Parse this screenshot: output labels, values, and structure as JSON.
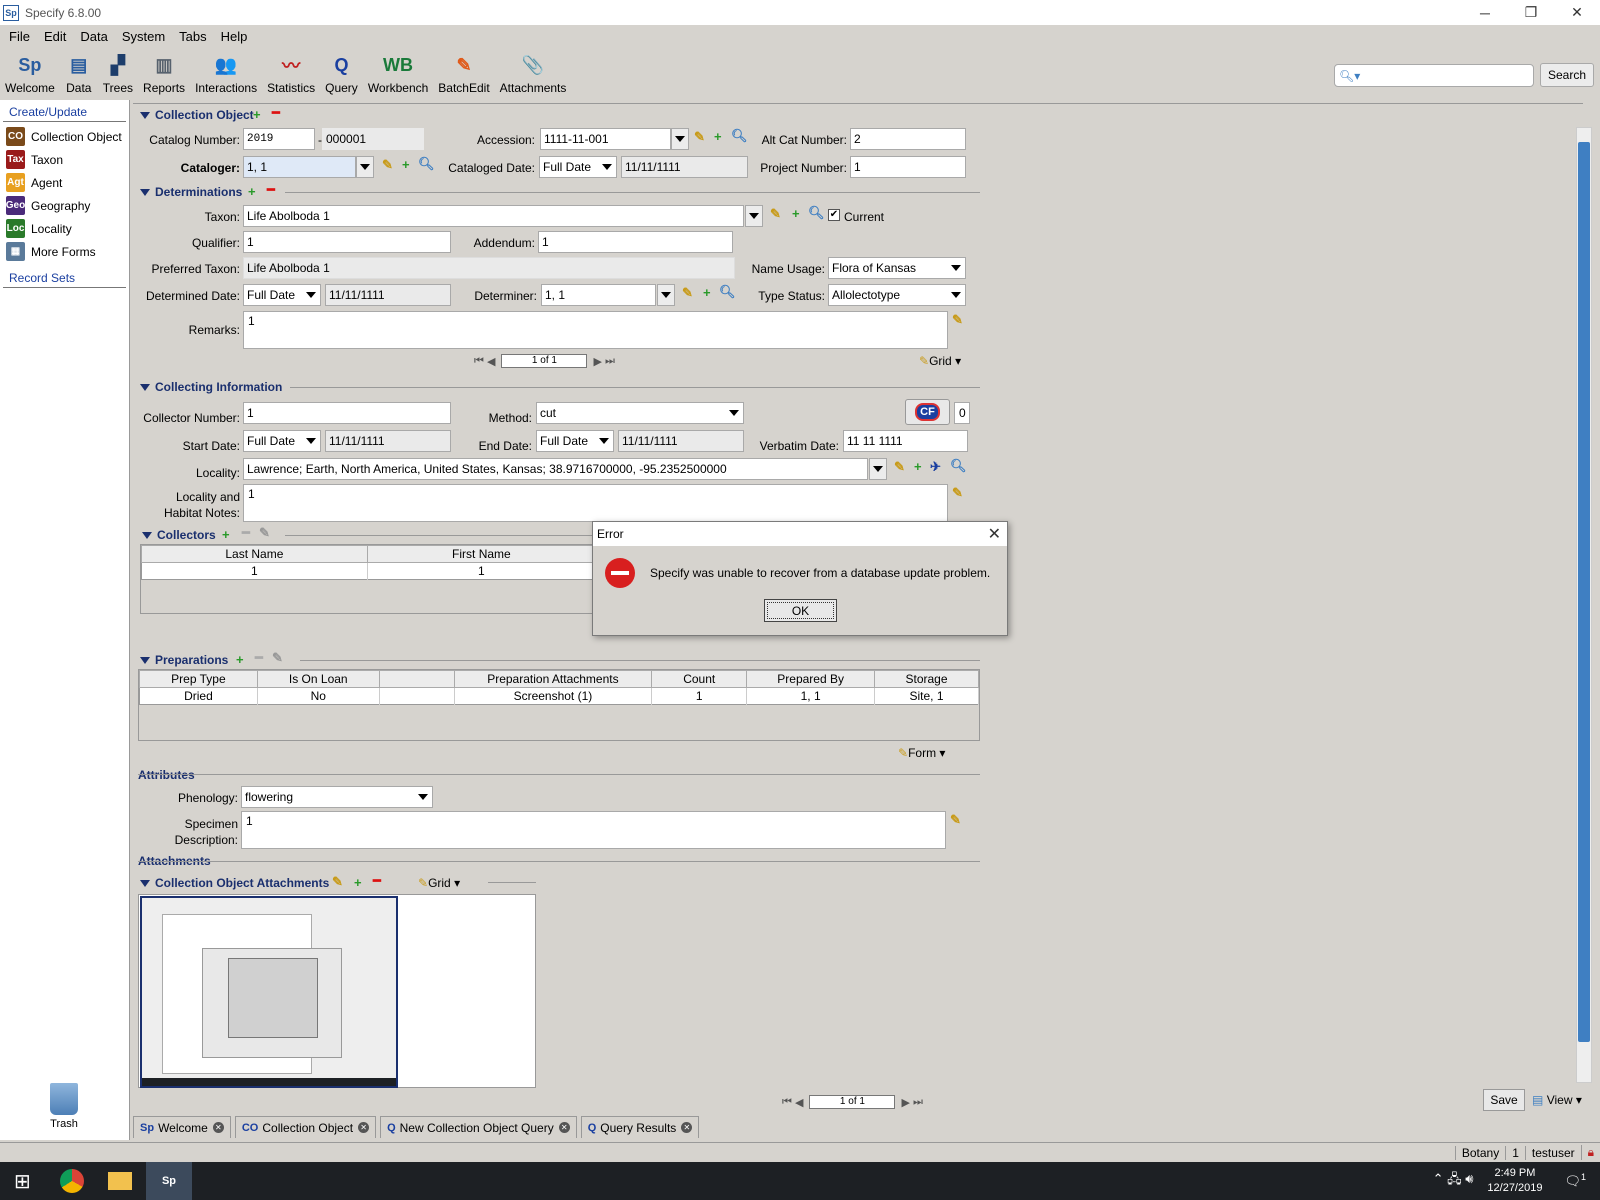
{
  "window": {
    "title": "Specify 6.8.00",
    "logo": "Sp",
    "min": "─",
    "restore": "❐",
    "close": "✕"
  },
  "menu": [
    "File",
    "Edit",
    "Data",
    "System",
    "Tabs",
    "Help"
  ],
  "toolbar": [
    {
      "label": "Welcome",
      "icon": "specify-logo-icon",
      "glyph": "Sp",
      "color": "#2a5d9f"
    },
    {
      "label": "Data",
      "icon": "data-form-icon",
      "glyph": "▤",
      "color": "#2a5d9f"
    },
    {
      "label": "Trees",
      "icon": "trees-icon",
      "glyph": "▞",
      "color": "#1d3d6b"
    },
    {
      "label": "Reports",
      "icon": "reports-icon",
      "glyph": "▥",
      "color": "#56616d"
    },
    {
      "label": "Interactions",
      "icon": "interactions-icon",
      "glyph": "👥",
      "color": "#c86a1a"
    },
    {
      "label": "Statistics",
      "icon": "statistics-icon",
      "glyph": "〰",
      "color": "#c02020"
    },
    {
      "label": "Query",
      "icon": "query-icon",
      "glyph": "Q",
      "color": "#1a3fa0"
    },
    {
      "label": "Workbench",
      "icon": "workbench-icon",
      "glyph": "WB",
      "color": "#1a7a3a"
    },
    {
      "label": "BatchEdit",
      "icon": "batchedit-icon",
      "glyph": "✎",
      "color": "#e05a1a"
    },
    {
      "label": "Attachments",
      "icon": "attachments-icon",
      "glyph": "📎",
      "color": "#666"
    }
  ],
  "search": {
    "placeholder": "",
    "button": "Search"
  },
  "sidebar": {
    "create_header": "Create/Update",
    "items": [
      {
        "label": "Collection Object",
        "abbr": "CO",
        "color": "#7a4a1a"
      },
      {
        "label": "Taxon",
        "abbr": "Tax",
        "color": "#9a1a1a"
      },
      {
        "label": "Agent",
        "abbr": "Agt",
        "color": "#e8a020"
      },
      {
        "label": "Geography",
        "abbr": "Geo",
        "color": "#4a2a7a"
      },
      {
        "label": "Locality",
        "abbr": "Loc",
        "color": "#2a7a2a"
      },
      {
        "label": "More Forms",
        "abbr": "▦",
        "color": "#5a7a9a"
      }
    ],
    "record_sets": "Record Sets",
    "trash": "Trash"
  },
  "co": {
    "section": "Collection Object",
    "catalog_number_label": "Catalog Number:",
    "catalog_prefix": "2019",
    "catalog_sep": "-",
    "catalog_suffix": "000001",
    "accession_label": "Accession:",
    "accession": "1111-11-001",
    "alt_cat_label": "Alt Cat Number:",
    "alt_cat": "2",
    "cataloger_label": "Cataloger:",
    "cataloger": "1, 1",
    "cataloged_date_label": "Cataloged Date:",
    "cataloged_date_type": "Full Date",
    "cataloged_date": "11/11/1111",
    "project_number_label": "Project Number:",
    "project_number": "1"
  },
  "det": {
    "section": "Determinations",
    "taxon_label": "Taxon:",
    "taxon": "Life Abolboda 1",
    "current_label": "Current",
    "current_check": "✔",
    "qualifier_label": "Qualifier:",
    "qualifier": "1",
    "addendum_label": "Addendum:",
    "addendum": "1",
    "preferred_label": "Preferred Taxon:",
    "preferred": "Life Abolboda 1",
    "name_usage_label": "Name Usage:",
    "name_usage": "Flora of Kansas",
    "det_date_label": "Determined Date:",
    "det_date_type": "Full Date",
    "det_date": "11/11/1111",
    "determiner_label": "Determiner:",
    "determiner": "1, 1",
    "type_status_label": "Type Status:",
    "type_status": "Allolectotype",
    "remarks_label": "Remarks:",
    "remarks": "1",
    "pager": "1 of 1",
    "grid": "Grid"
  },
  "ci": {
    "section": "Collecting Information",
    "collector_number_label": "Collector Number:",
    "collector_number": "1",
    "method_label": "Method:",
    "method": "cut",
    "cf_badge": "CF",
    "cf_count": "0",
    "start_date_label": "Start Date:",
    "start_date_type": "Full Date",
    "start_date": "11/11/1111",
    "end_date_label": "End Date:",
    "end_date_type": "Full Date",
    "end_date": "11/11/1111",
    "verbatim_date_label": "Verbatim Date:",
    "verbatim_date": "11 11 1111",
    "locality_label": "Locality:",
    "locality": "Lawrence; Earth, North America, United States, Kansas; 38.9716700000, -95.2352500000",
    "habitat_label_1": "Locality and",
    "habitat_label_2": "Habitat Notes:",
    "habitat": "1"
  },
  "collectors": {
    "section": "Collectors",
    "columns": [
      "Last Name",
      "First Name"
    ],
    "rows": [
      [
        "1",
        "1"
      ]
    ]
  },
  "preps": {
    "section": "Preparations",
    "columns": [
      "Prep Type",
      "Is On Loan",
      "",
      "Preparation Attachments",
      "Count",
      "Prepared By",
      "Storage"
    ],
    "rows": [
      [
        "Dried",
        "No",
        "",
        "Screenshot (1)",
        "1",
        "1, 1",
        "Site, 1"
      ]
    ],
    "form": "Form"
  },
  "attrs": {
    "section": "Attributes",
    "phenology_label": "Phenology:",
    "phenology": "flowering",
    "spec_desc_label_1": "Specimen",
    "spec_desc_label_2": "Description:",
    "spec_desc": "1"
  },
  "attachments": {
    "section": "Attachments",
    "coa_section": "Collection Object Attachments",
    "grid": "Grid"
  },
  "bottom": {
    "pager": "1 of 1",
    "save": "Save",
    "view": "View"
  },
  "tabs": [
    {
      "label": "Welcome",
      "icon": "specify-logo-icon",
      "glyph": "Sp"
    },
    {
      "label": "Collection Object",
      "icon": "collection-object-icon",
      "glyph": "CO"
    },
    {
      "label": "New Collection Object Query",
      "icon": "query-icon",
      "glyph": "Q"
    },
    {
      "label": "Query Results",
      "icon": "query-icon",
      "glyph": "Q"
    }
  ],
  "status": {
    "discipline": "Botany",
    "count": "1",
    "user": "testuser"
  },
  "taskbar": {
    "time": "2:49 PM",
    "date": "12/27/2019",
    "notif": "1"
  },
  "dialog": {
    "title": "Error",
    "message": "Specify was unable to recover from a database update problem.",
    "ok": "OK"
  }
}
